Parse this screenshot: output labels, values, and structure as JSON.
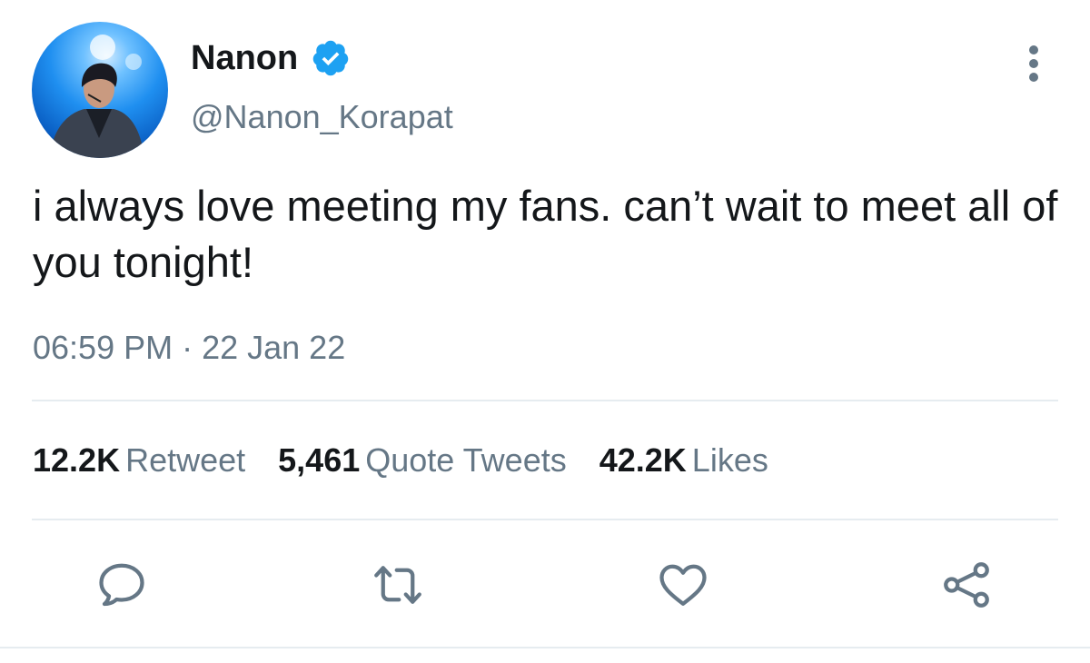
{
  "author": {
    "display_name": "Nanon",
    "handle": "@Nanon_Korapat",
    "verified": true,
    "avatar_icon": "profile-photo"
  },
  "tweet": {
    "text": "i always love meeting my fans. can’t wait to meet all of you tonight!",
    "timestamp": "06:59 PM · 22 Jan 22"
  },
  "stats": {
    "retweets_count": "12.2K",
    "retweets_label": "Retweet",
    "quotes_count": "5,461",
    "quotes_label": "Quote Tweets",
    "likes_count": "42.2K",
    "likes_label": "Likes"
  },
  "actions": {
    "reply_icon": "comment-icon",
    "retweet_icon": "retweet-icon",
    "like_icon": "heart-icon",
    "share_icon": "share-icon"
  },
  "colors": {
    "text_primary": "#14171a",
    "text_secondary": "#657786",
    "verified_blue": "#1da1f2",
    "divider": "#e6ecf0"
  }
}
